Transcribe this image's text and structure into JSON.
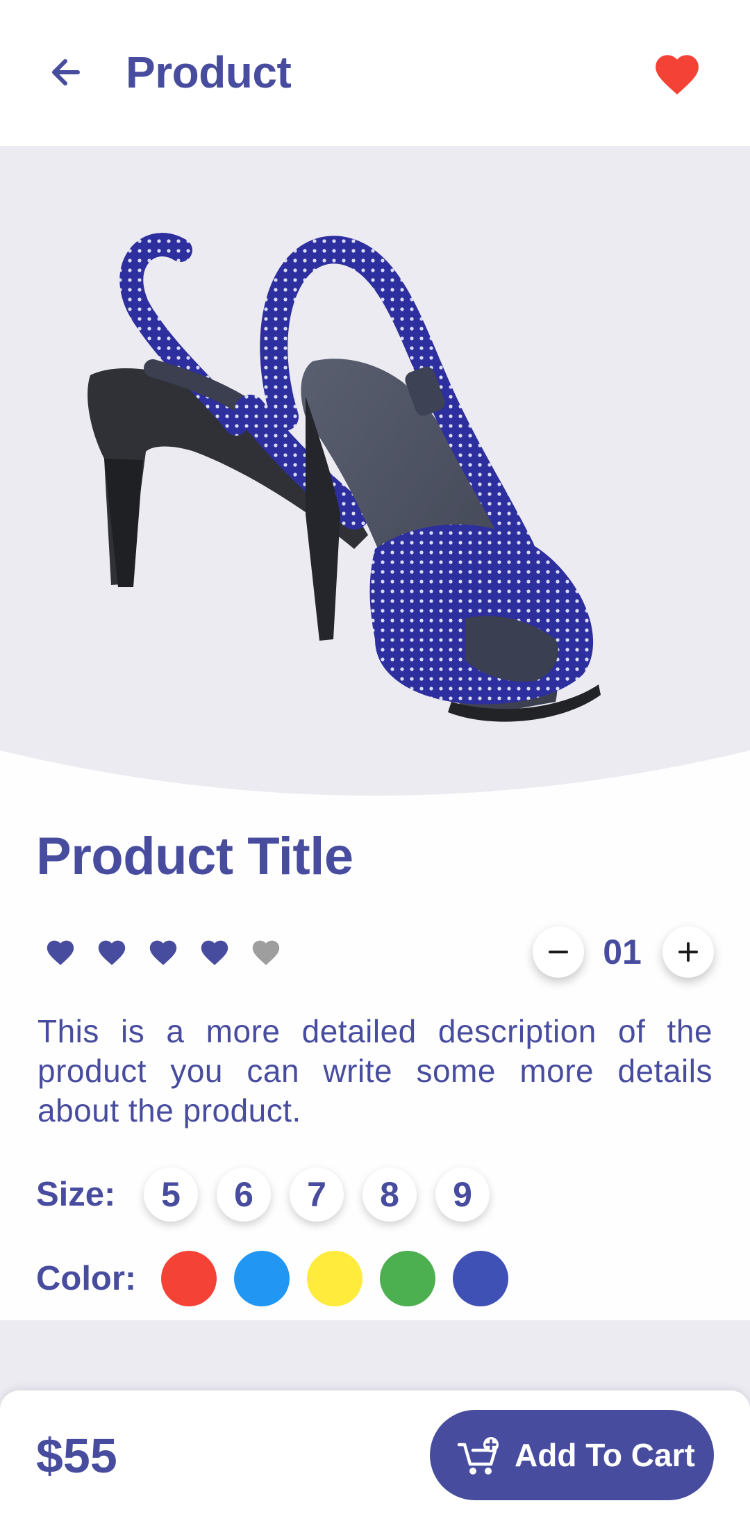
{
  "header": {
    "title": "Product",
    "back_icon": "arrow-left-icon",
    "favorite_icon": "heart-icon",
    "favorite_color": "#f44336"
  },
  "product": {
    "title": "Product Title",
    "image_icon": "high-heel-sandal-image",
    "rating": {
      "value": 4,
      "max": 5,
      "active_color": "#474c9e",
      "inactive_color": "#9e9e9e"
    },
    "quantity": "01",
    "description": "This is a more detailed description of the product you can write some more details about the product.",
    "size_label": "Size:",
    "sizes": [
      "5",
      "6",
      "7",
      "8",
      "9"
    ],
    "color_label": "Color:",
    "colors": [
      "#f44336",
      "#2196f3",
      "#ffeb3b",
      "#4caf50",
      "#3f51b5"
    ]
  },
  "footer": {
    "price": "$55",
    "add_to_cart_label": "Add To Cart",
    "cart_icon": "cart-plus-icon"
  },
  "theme": {
    "accent": "#474c9e",
    "background": "#ecebf2"
  }
}
